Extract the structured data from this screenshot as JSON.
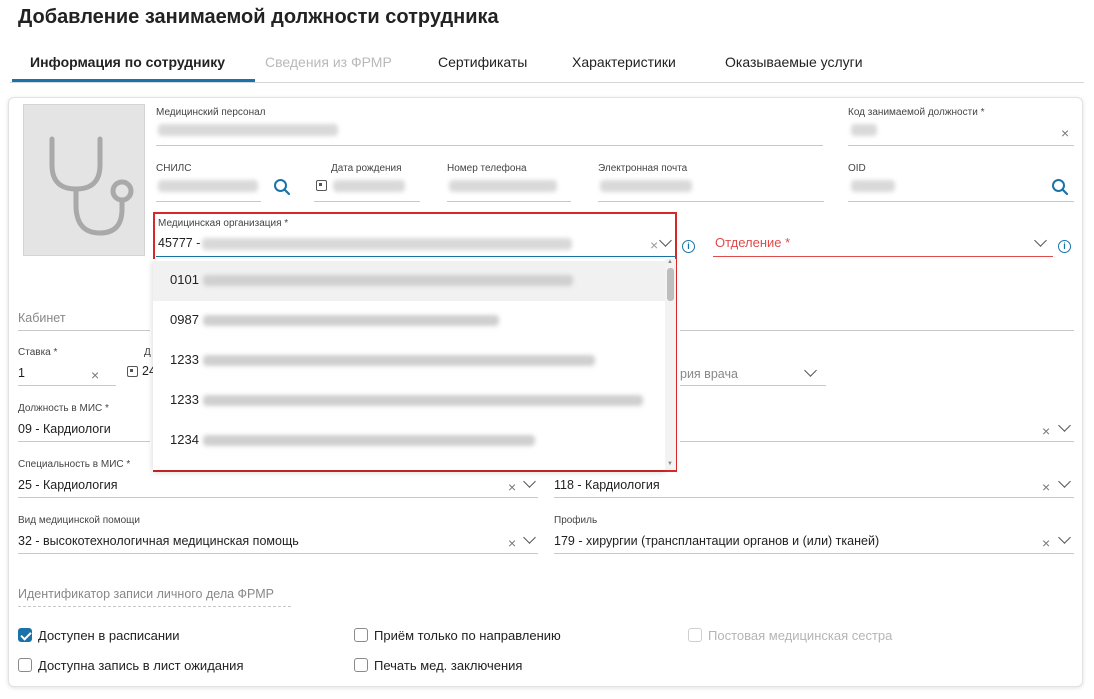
{
  "page_title": "Добавление занимаемой должности сотрудника",
  "tabs": [
    {
      "label": "Информация по сотруднику",
      "state": "active"
    },
    {
      "label": "Сведения из ФРМР",
      "state": "disabled"
    },
    {
      "label": "Сертификаты",
      "state": "normal"
    },
    {
      "label": "Характеристики",
      "state": "normal"
    },
    {
      "label": "Оказываемые услуги",
      "state": "normal"
    }
  ],
  "form": {
    "med_personnel_label": "Медицинский персонал",
    "position_code_label": "Код занимаемой должности *",
    "snils_label": "СНИЛС",
    "birth_date_label": "Дата рождения",
    "phone_label": "Номер телефона",
    "email_label": "Электронная почта",
    "oid_label": "OID",
    "med_org_label": "Медицинская организация *",
    "med_org_value_prefix": "45777 -",
    "department_label": "Отделение *",
    "cabinet_label": "Кабинет",
    "rate_label": "Ставка *",
    "rate_value": "1",
    "date_label_partial": "Д",
    "date_value_partial": "24",
    "doctor_category_placeholder": "рия врача",
    "position_mis_label": "Должность в МИС *",
    "position_mis_value": "09 - Кардиологи",
    "specialty_mis_label": "Специальность в МИС *",
    "specialty_mis_value": "25 - Кардиология",
    "specialty_right_value": "118 - Кардиология",
    "care_type_label": "Вид медицинской помощи",
    "care_type_value": "32 - высокотехнологичная медицинская помощь",
    "profile_label": "Профиль",
    "profile_value": "179 - хирургии (трансплантации органов и (или) тканей)",
    "frmr_id_placeholder": "Идентификатор записи личного дела ФРМР"
  },
  "dropdown_items": [
    {
      "code": "0101",
      "hover": true
    },
    {
      "code": "0987",
      "hover": false
    },
    {
      "code": "1233",
      "hover": false
    },
    {
      "code": "1233",
      "hover": false
    },
    {
      "code": "1234",
      "hover": false
    }
  ],
  "checkboxes": [
    {
      "label": "Доступен в расписании",
      "checked": true,
      "disabled": false
    },
    {
      "label": "Приём только по направлению",
      "checked": false,
      "disabled": false
    },
    {
      "label": "Постовая медицинская сестра",
      "checked": false,
      "disabled": true
    },
    {
      "label": "Доступна запись в лист ожидания",
      "checked": false,
      "disabled": false
    },
    {
      "label": "Печать мед. заключения",
      "checked": false,
      "disabled": false
    }
  ],
  "icons": {
    "clear": "×",
    "info": "i"
  },
  "colors": {
    "accent": "#1a73a8",
    "required_error": "#e04b4b",
    "highlight_border": "#d62828"
  }
}
